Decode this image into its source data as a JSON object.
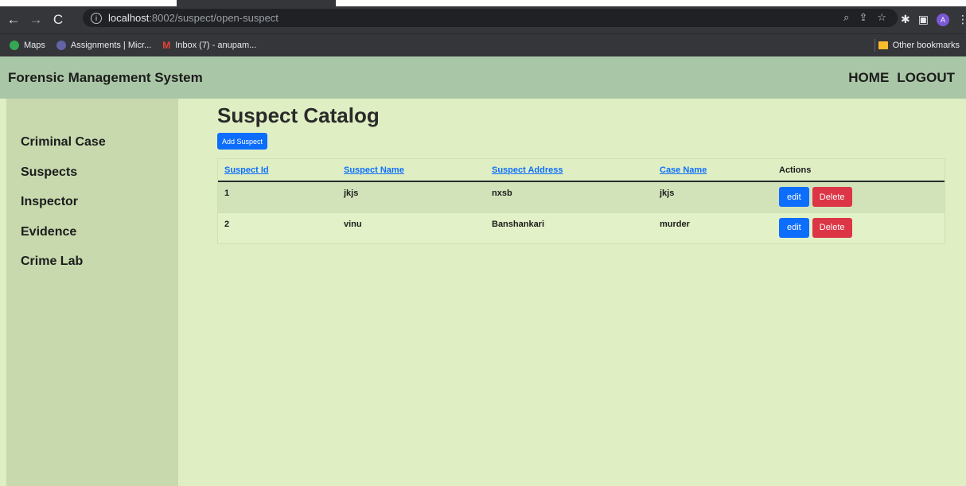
{
  "browser": {
    "url_host": "localhost",
    "url_path": ":8002/suspect/open-suspect",
    "bookmarks": [
      "Maps",
      "Assignments | Micr...",
      "Inbox (7) - anupam..."
    ],
    "other_bookmarks": "Other bookmarks",
    "profile_initial": "A"
  },
  "app": {
    "brand": "Forensic Management System",
    "nav": {
      "home": "HOME",
      "logout": "LOGOUT"
    }
  },
  "sidebar": {
    "items": [
      {
        "label": "Criminal Case"
      },
      {
        "label": "Suspects"
      },
      {
        "label": "Inspector"
      },
      {
        "label": "Evidence"
      },
      {
        "label": "Crime Lab"
      }
    ]
  },
  "main": {
    "title": "Suspect Catalog",
    "add_button": "Add Suspect"
  },
  "table": {
    "headers": [
      "Suspect Id",
      "Suspect Name",
      "Suspect Address",
      "Case Name",
      "Actions"
    ],
    "rows": [
      {
        "id": "1",
        "name": "jkjs",
        "address": "nxsb",
        "case": "jkjs"
      },
      {
        "id": "2",
        "name": "vinu",
        "address": "Banshankari",
        "case": "murder"
      }
    ],
    "edit_label": "edit",
    "delete_label": "Delete"
  },
  "colors": {
    "header_bg": "#a9c7a6",
    "sidebar_bg": "#c7d9ad",
    "page_bg": "#dfefc3",
    "primary": "#0d6efd",
    "danger": "#dc3545"
  }
}
